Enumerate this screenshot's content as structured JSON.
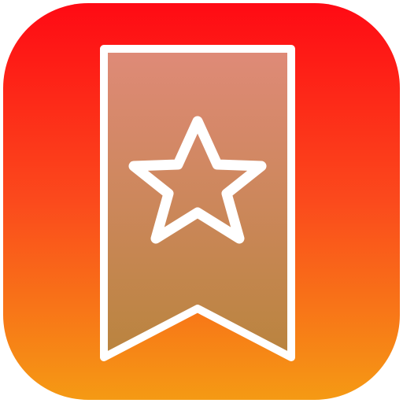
{
  "app_icon": {
    "icon_name": "bookmark-star-icon",
    "colors": {
      "background_top": "#ff0a14",
      "background_mid": "#fb4a1c",
      "background_bottom": "#f59a14",
      "ribbon_fill_top": "#df8a78",
      "ribbon_fill_bottom": "#b9843e",
      "outline": "#ffffff"
    }
  }
}
